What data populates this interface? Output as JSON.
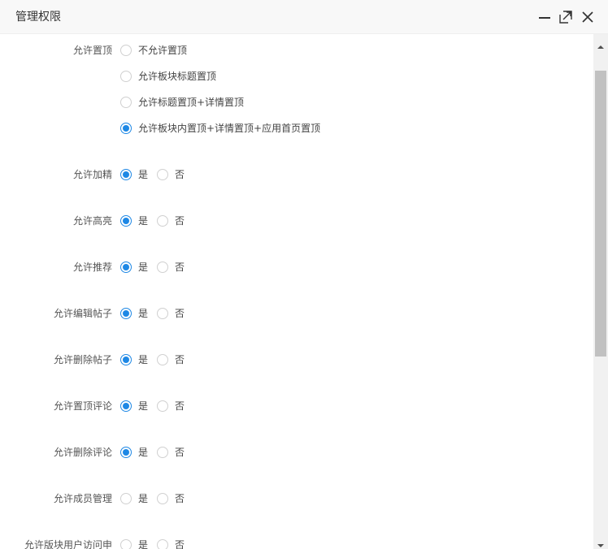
{
  "dialog": {
    "title": "管理权限",
    "controls": [
      "minimize-icon",
      "maximize-icon",
      "close-icon"
    ]
  },
  "form": {
    "pin": {
      "label": "允许置顶",
      "options": [
        {
          "text": "不允许置顶",
          "checked": false
        },
        {
          "text": "允许板块标题置顶",
          "checked": false
        },
        {
          "text": "允许标题置顶+详情置顶",
          "checked": false
        },
        {
          "text": "允许板块内置顶+详情置顶+应用首页置顶",
          "checked": true
        }
      ]
    },
    "rows": [
      {
        "label": "允许加精",
        "yes": "是",
        "no": "否",
        "selected": "yes"
      },
      {
        "label": "允许高亮",
        "yes": "是",
        "no": "否",
        "selected": "yes"
      },
      {
        "label": "允许推荐",
        "yes": "是",
        "no": "否",
        "selected": "yes"
      },
      {
        "label": "允许编辑帖子",
        "yes": "是",
        "no": "否",
        "selected": "yes"
      },
      {
        "label": "允许删除帖子",
        "yes": "是",
        "no": "否",
        "selected": "yes"
      },
      {
        "label": "允许置顶评论",
        "yes": "是",
        "no": "否",
        "selected": "yes"
      },
      {
        "label": "允许删除评论",
        "yes": "是",
        "no": "否",
        "selected": "yes"
      },
      {
        "label": "允许成员管理",
        "yes": "是",
        "no": "否",
        "selected": "none"
      },
      {
        "label": "允许版块用户访问申",
        "yes": "是",
        "no": "否",
        "selected": "none"
      }
    ]
  },
  "colors": {
    "accent": "#1e88e5",
    "titlebar": "#f8f8f8",
    "scroll_thumb": "#c1c1c1"
  }
}
